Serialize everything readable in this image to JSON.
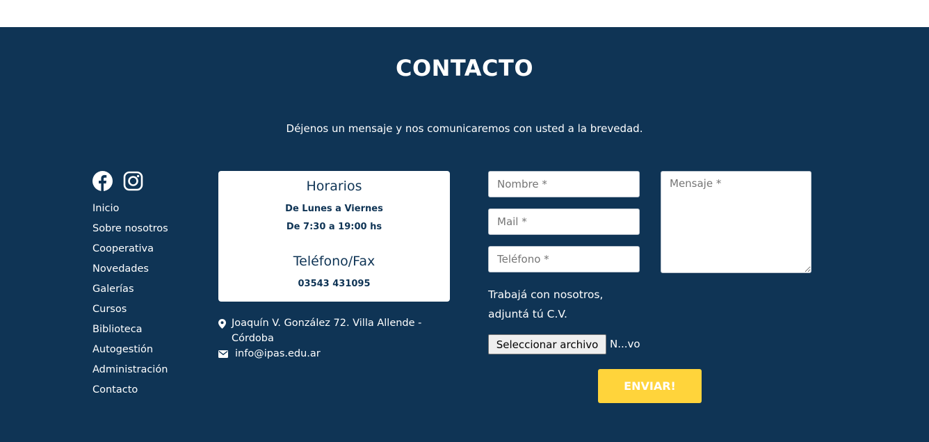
{
  "contact": {
    "title": "CONTACTO",
    "subtitle": "Déjenos un mensaje y nos comunicaremos con usted a la brevedad."
  },
  "social": [
    {
      "icon": "facebook-icon"
    },
    {
      "icon": "instagram-icon"
    }
  ],
  "nav": [
    "Inicio",
    "Sobre nosotros",
    "Cooperativa",
    "Novedades",
    "Galerías",
    "Cursos",
    "Biblioteca",
    "Autogestión",
    "Administración",
    "Contacto"
  ],
  "info_card": {
    "hours_title": "Horarios",
    "hours_days": "De Lunes a Viernes",
    "hours_time": "De 7:30 a 19:00 hs",
    "phone_title": "Teléfono/Fax",
    "phone_number": "03543 431095"
  },
  "address": {
    "icon": "map-marker-icon",
    "text": "Joaquín V. González 72. Villa Allende - Córdoba"
  },
  "email": {
    "icon": "envelope-icon",
    "text": "info@ipas.edu.ar"
  },
  "form": {
    "name_placeholder": "Nombre *",
    "mail_placeholder": "Mail *",
    "phone_placeholder": "Teléfono *",
    "message_placeholder": "Mensaje *",
    "cv_line1": "Trabajá con nosotros,",
    "cv_line2": "adjuntá tú C.V.",
    "file_button": "Seleccionar archivo",
    "file_status": "N...vo",
    "submit_label": "ENVIAR!"
  },
  "colors": {
    "background": "#0f3455",
    "card": "#ffffff",
    "accent": "#ffd43b"
  }
}
